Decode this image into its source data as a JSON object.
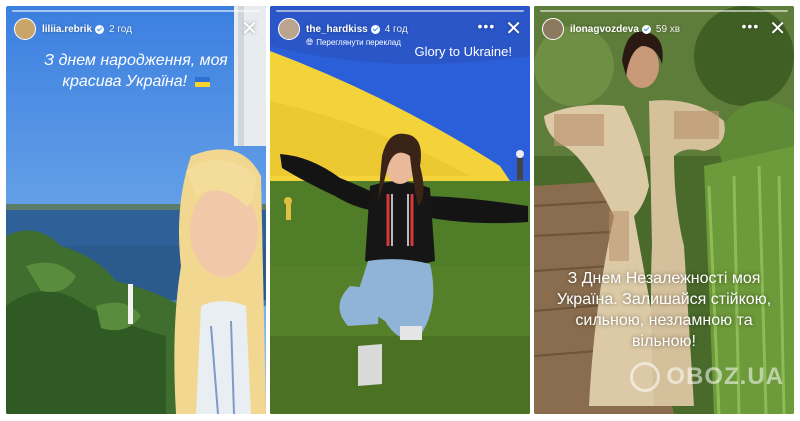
{
  "stories": [
    {
      "username": "liliia.rebrik",
      "time": "2 год",
      "caption": "З днем народження, моя красива Україна!",
      "colors": {
        "sky": "#4f8fe0",
        "water": "#2d5c91",
        "trees": "#3e6b33"
      },
      "icons": {
        "avatar": "avatar-icon",
        "verified": "verified-badge-icon",
        "more": "more-options-icon",
        "close": "close-icon",
        "flag": "ukraine-flag-icon"
      }
    },
    {
      "username": "the_hardkiss",
      "time": "4 год",
      "translate": "Переглянути переклад",
      "caption": "Glory to Ukraine!",
      "colors": {
        "flag_blue": "#2b5fd9",
        "flag_yellow": "#f4d23a",
        "grass": "#4c7a28"
      },
      "icons": {
        "avatar": "avatar-icon",
        "verified": "verified-badge-icon",
        "more": "more-options-icon",
        "close": "close-icon",
        "globe": "globe-icon"
      }
    },
    {
      "username": "ilonagvozdeva",
      "time": "59 хв",
      "caption": "З Днем Незалежності моя Україна. Залишайся стійкою, сильною, незламною та вільною!",
      "colors": {
        "foliage": "#4e6a2e",
        "boardwalk": "#8a6d4e",
        "dress": "#d9c8a8"
      },
      "icons": {
        "avatar": "avatar-icon",
        "verified": "verified-badge-icon",
        "more": "more-options-icon",
        "close": "close-icon"
      }
    }
  ],
  "watermark": "OBOZ.UA"
}
